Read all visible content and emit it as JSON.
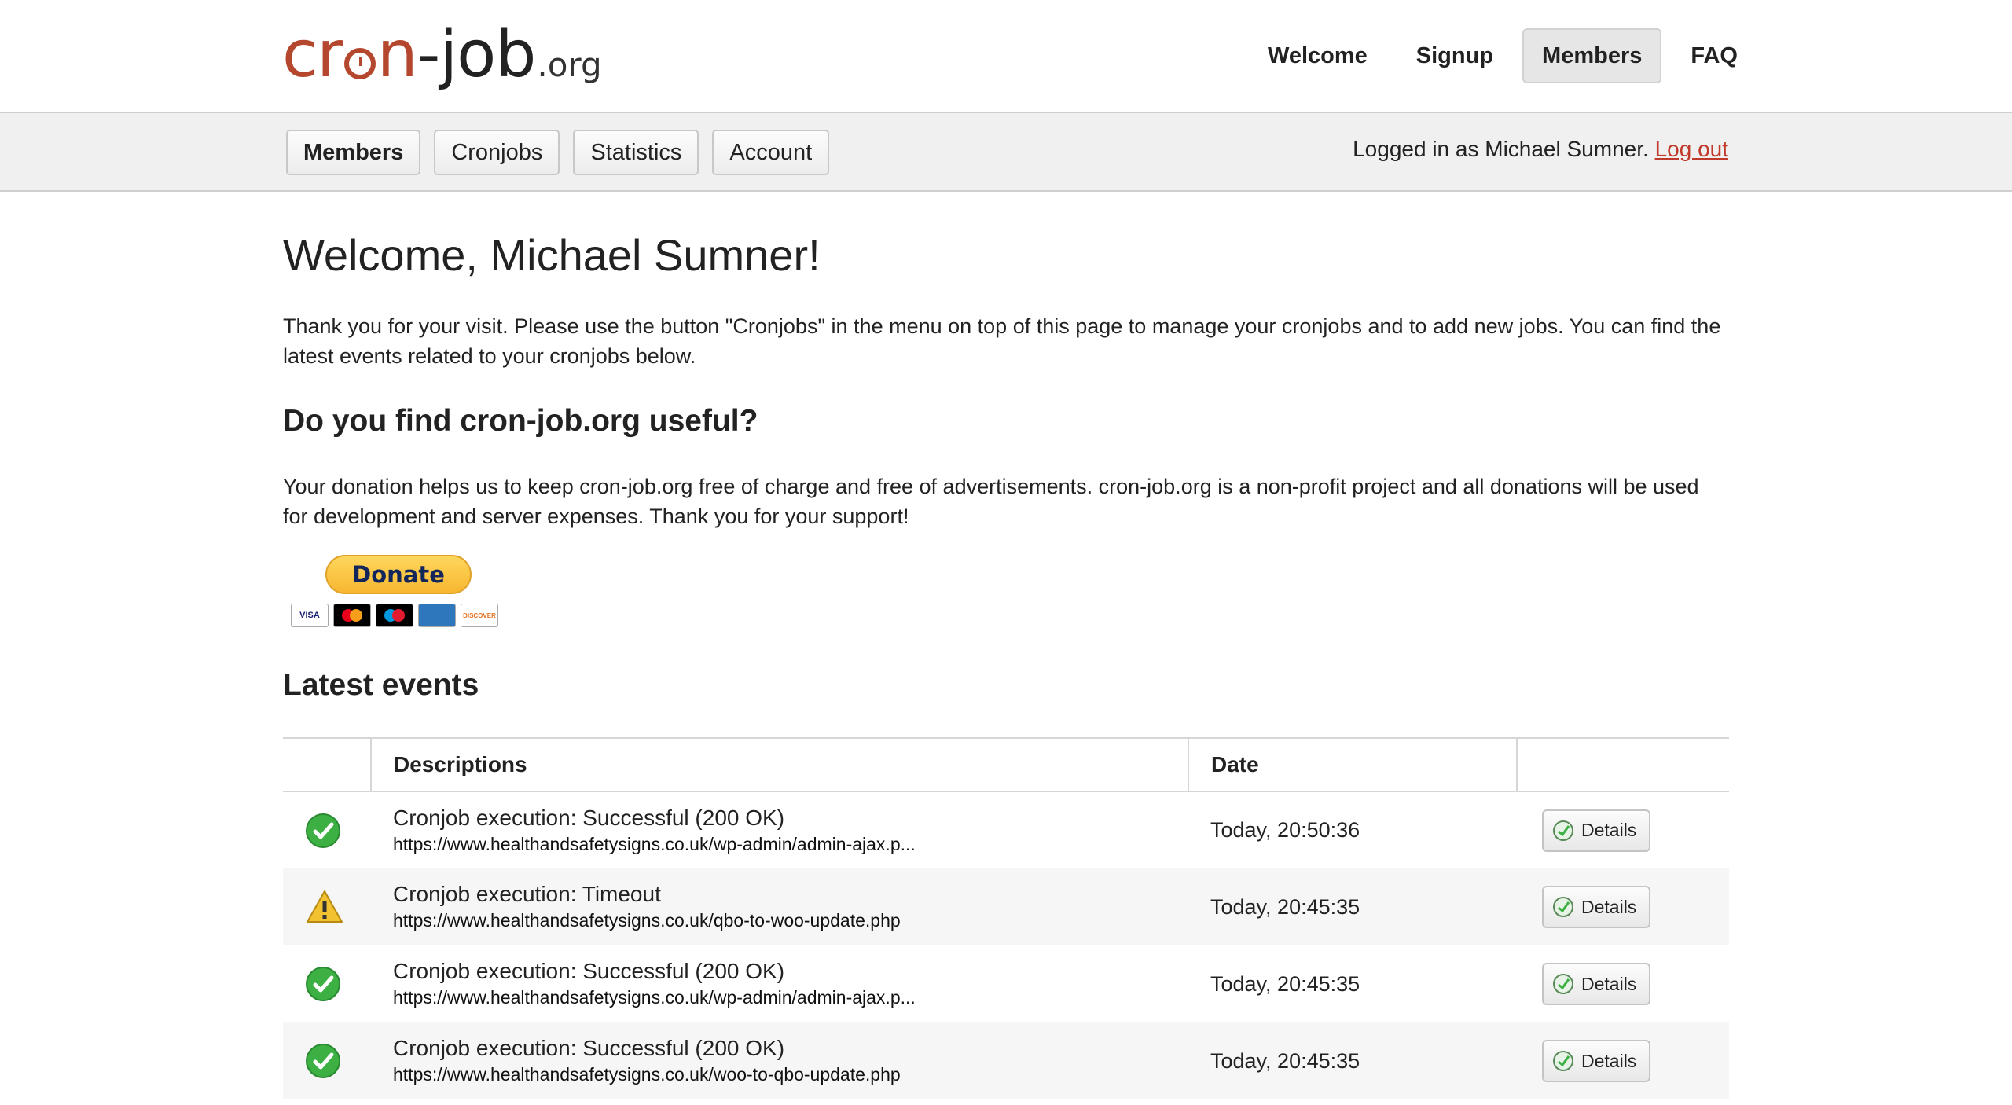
{
  "logo": {
    "cron_a": "cr",
    "cron_b": "n",
    "job": "-job",
    "org": ".org"
  },
  "top_nav": [
    {
      "label": "Welcome"
    },
    {
      "label": "Signup"
    },
    {
      "label": "Members",
      "active": true
    },
    {
      "label": "FAQ"
    }
  ],
  "sub_nav": [
    {
      "label": "Members",
      "active": true
    },
    {
      "label": "Cronjobs"
    },
    {
      "label": "Statistics"
    },
    {
      "label": "Account"
    }
  ],
  "login": {
    "prefix": "Logged in as Michael Sumner.",
    "logout": "Log out"
  },
  "main": {
    "title": "Welcome, Michael Sumner!",
    "intro": "Thank you for your visit. Please use the button \"Cronjobs\" in the menu on top of this page to manage your cronjobs and to add new jobs. You can find the latest events related to your cronjobs below.",
    "useful_heading": "Do you find cron-job.org useful?",
    "donation_text": "Your donation helps us to keep cron-job.org free of charge and free of advertisements. cron-job.org is a non-profit project and all donations will be used for development and server expenses. Thank you for your support!",
    "donate_label": "Donate",
    "cards": [
      "VISA",
      "",
      "",
      "",
      "DISCOVER"
    ],
    "events_heading": "Latest events"
  },
  "table": {
    "headers": [
      "",
      "Descriptions",
      "Date",
      ""
    ],
    "rows": [
      {
        "status": "success",
        "title": "Cronjob execution: Successful (200 OK)",
        "url": "https://www.healthandsafetysigns.co.uk/wp-admin/admin-ajax.p...",
        "date": "Today, 20:50:36",
        "action": "Details"
      },
      {
        "status": "warning",
        "title": "Cronjob execution: Timeout",
        "url": "https://www.healthandsafetysigns.co.uk/qbo-to-woo-update.php",
        "date": "Today, 20:45:35",
        "action": "Details"
      },
      {
        "status": "success",
        "title": "Cronjob execution: Successful (200 OK)",
        "url": "https://www.healthandsafetysigns.co.uk/wp-admin/admin-ajax.p...",
        "date": "Today, 20:45:35",
        "action": "Details"
      },
      {
        "status": "success",
        "title": "Cronjob execution: Successful (200 OK)",
        "url": "https://www.healthandsafetysigns.co.uk/woo-to-qbo-update.php",
        "date": "Today, 20:45:35",
        "action": "Details"
      }
    ]
  },
  "colors": {
    "brand": "#b5472e",
    "link": "#c0392b",
    "success": "#3cb043",
    "warning": "#f2c230"
  }
}
